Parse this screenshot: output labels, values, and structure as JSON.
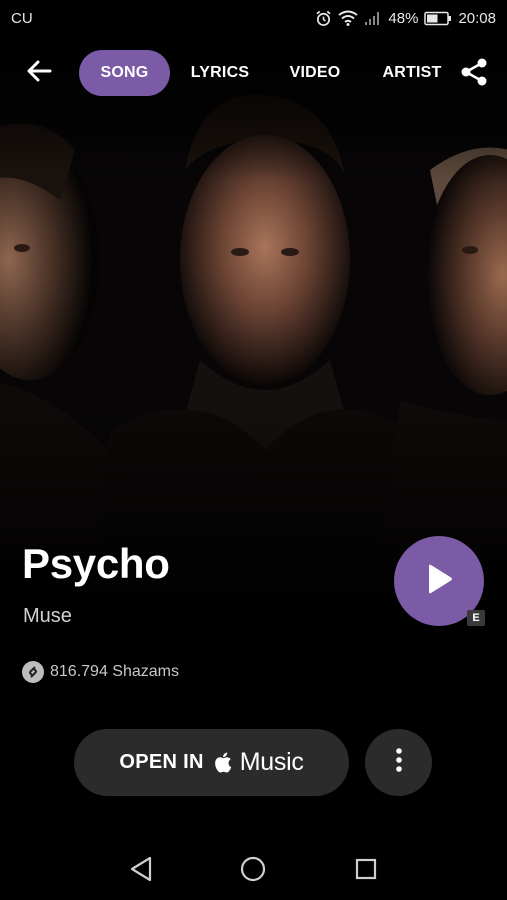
{
  "status_bar": {
    "carrier": "CU",
    "battery": "48%",
    "time": "20:08",
    "icons": [
      "alarm-icon",
      "wifi-icon",
      "signal-icon",
      "battery-icon"
    ]
  },
  "top_nav": {
    "tabs": [
      {
        "label": "SONG",
        "active": true
      },
      {
        "label": "LYRICS",
        "active": false
      },
      {
        "label": "VIDEO",
        "active": false
      },
      {
        "label": "ARTIST",
        "active": false
      }
    ],
    "icons": [
      "back-arrow-icon",
      "share-icon"
    ]
  },
  "song": {
    "title": "Psycho",
    "artist": "Muse",
    "shazams": "816.794 Shazams",
    "explicit_badge": "E"
  },
  "actions": {
    "open_in": "OPEN IN",
    "music_service": "Music",
    "icons": [
      "apple-icon",
      "more-vertical-icon",
      "play-icon"
    ]
  },
  "nav_bar": {
    "icons": [
      "nav-back-icon",
      "nav-home-icon",
      "nav-recent-icon"
    ]
  },
  "colors": {
    "accent": "#7b5aa6",
    "button_bg": "#2b2b2b",
    "background": "#000000"
  }
}
